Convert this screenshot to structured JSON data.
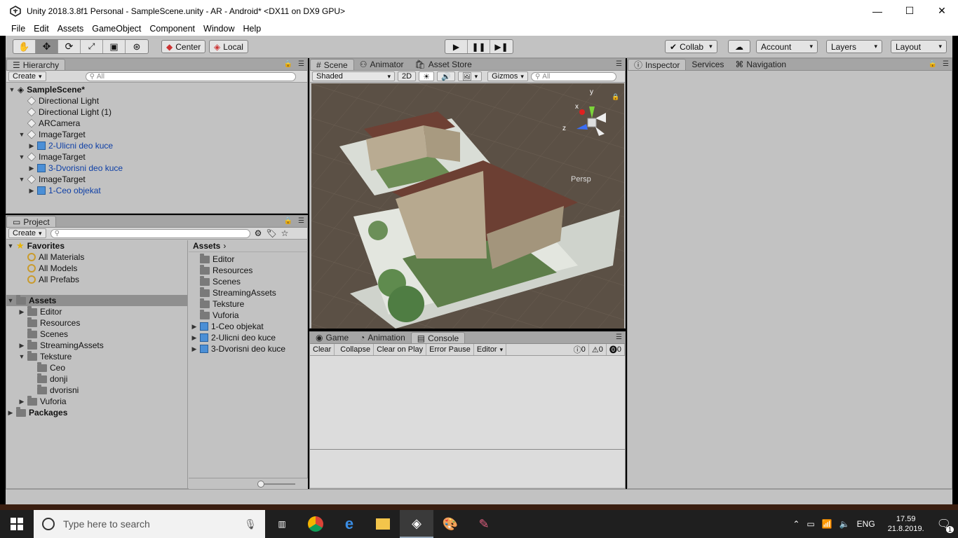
{
  "window": {
    "title": "Unity 2018.3.8f1 Personal - SampleScene.unity - AR - Android* <DX11 on DX9 GPU>"
  },
  "menu": [
    "File",
    "Edit",
    "Assets",
    "GameObject",
    "Component",
    "Window",
    "Help"
  ],
  "toolbar": {
    "center_label": "Center",
    "local_label": "Local",
    "collab_label": "Collab",
    "account_label": "Account",
    "layers_label": "Layers",
    "layout_label": "Layout"
  },
  "hierarchy": {
    "tab": "Hierarchy",
    "create": "Create",
    "search_placeholder": "All",
    "scene": "SampleScene*",
    "items": [
      {
        "label": "Directional Light",
        "indent": 1,
        "type": "go",
        "expand": ""
      },
      {
        "label": "Directional Light (1)",
        "indent": 1,
        "type": "go",
        "expand": ""
      },
      {
        "label": "ARCamera",
        "indent": 1,
        "type": "go",
        "expand": ""
      },
      {
        "label": "ImageTarget",
        "indent": 1,
        "type": "go",
        "expand": "▼"
      },
      {
        "label": "2-Ulicni deo kuce",
        "indent": 2,
        "type": "prefab",
        "expand": "▶"
      },
      {
        "label": "ImageTarget",
        "indent": 1,
        "type": "go",
        "expand": "▼"
      },
      {
        "label": "3-Dvorisni deo kuce",
        "indent": 2,
        "type": "prefab",
        "expand": "▶"
      },
      {
        "label": "ImageTarget",
        "indent": 1,
        "type": "go",
        "expand": "▼"
      },
      {
        "label": "1-Ceo objekat",
        "indent": 2,
        "type": "prefab",
        "expand": "▶"
      }
    ]
  },
  "project": {
    "tab": "Project",
    "create": "Create",
    "favorites": "Favorites",
    "fav_items": [
      "All Materials",
      "All Models",
      "All Prefabs"
    ],
    "assets_root": "Assets",
    "tree": [
      {
        "label": "Editor",
        "indent": 1,
        "expand": "▶"
      },
      {
        "label": "Resources",
        "indent": 1,
        "expand": ""
      },
      {
        "label": "Scenes",
        "indent": 1,
        "expand": ""
      },
      {
        "label": "StreamingAssets",
        "indent": 1,
        "expand": "▶"
      },
      {
        "label": "Teksture",
        "indent": 1,
        "expand": "▼"
      },
      {
        "label": "Ceo",
        "indent": 2,
        "expand": ""
      },
      {
        "label": "donji",
        "indent": 2,
        "expand": ""
      },
      {
        "label": "dvorisni",
        "indent": 2,
        "expand": ""
      },
      {
        "label": "Vuforia",
        "indent": 1,
        "expand": "▶"
      }
    ],
    "packages": "Packages",
    "breadcrumb": "Assets",
    "contents": [
      {
        "label": "Editor",
        "type": "folder"
      },
      {
        "label": "Resources",
        "type": "folder"
      },
      {
        "label": "Scenes",
        "type": "folder"
      },
      {
        "label": "StreamingAssets",
        "type": "folder"
      },
      {
        "label": "Teksture",
        "type": "folder"
      },
      {
        "label": "Vuforia",
        "type": "folder"
      },
      {
        "label": "1-Ceo objekat",
        "type": "prefab"
      },
      {
        "label": "2-Ulicni deo kuce",
        "type": "prefab"
      },
      {
        "label": "3-Dvorisni deo kuce",
        "type": "prefab"
      }
    ]
  },
  "scene_panel": {
    "tabs": [
      "Scene",
      "Animator",
      "Asset Store"
    ],
    "shading": "Shaded",
    "mode_2d": "2D",
    "gizmos": "Gizmos",
    "search_placeholder": "All",
    "persp": "Persp",
    "axis_y": "y",
    "axis_x": "x",
    "axis_z": "z"
  },
  "console_panel": {
    "tabs": [
      "Game",
      "Animation",
      "Console"
    ],
    "buttons": [
      "Clear",
      "Collapse",
      "Clear on Play",
      "Error Pause",
      "Editor"
    ],
    "log_count": "0",
    "warn_count": "0",
    "error_count": "0"
  },
  "inspector_panel": {
    "tabs": [
      "Inspector",
      "Services",
      "Navigation"
    ]
  },
  "taskbar": {
    "search_placeholder": "Type here to search",
    "lang": "ENG",
    "time": "17.59",
    "date": "21.8.2019.",
    "notifications": "1"
  }
}
